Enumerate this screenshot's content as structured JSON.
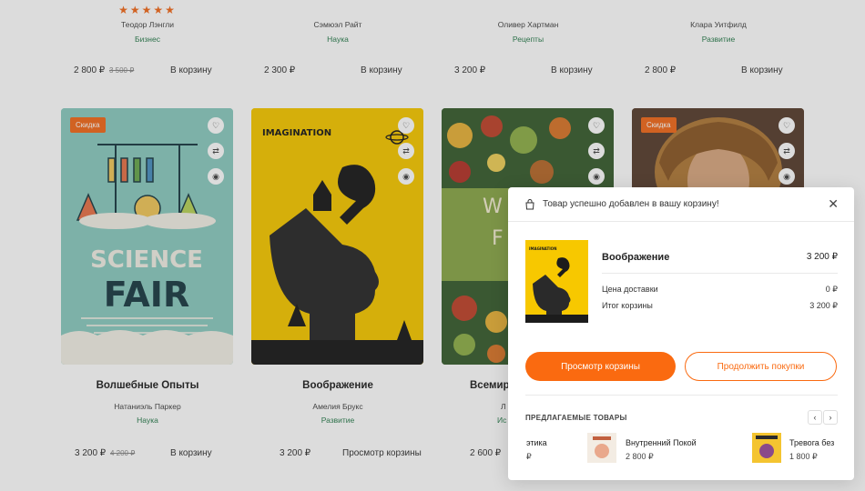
{
  "top_row": [
    {
      "stars": "★★★★★",
      "author": "Теодор Лэнгли",
      "category": "Бизнес",
      "price": "2 800 ₽",
      "old_price": "3 500 ₽",
      "cart": "В корзину"
    },
    {
      "stars": "",
      "author": "Сэмюэл Райт",
      "category": "Наука",
      "price": "2 300 ₽",
      "old_price": "",
      "cart": "В корзину"
    },
    {
      "stars": "",
      "author": "Оливер Хартман",
      "category": "Рецепты",
      "price": "3 200 ₽",
      "old_price": "",
      "cart": "В корзину"
    },
    {
      "stars": "",
      "author": "Клара Уитфилд",
      "category": "Развитие",
      "price": "2 800 ₽",
      "old_price": "",
      "cart": "В корзину"
    }
  ],
  "books": [
    {
      "badge": "Скидка",
      "cover_title_1": "SCIENCE",
      "cover_title_2": "FAIR",
      "title": "Волшебные Опыты",
      "author": "Натаниэль Паркер",
      "category": "Наука",
      "price": "3 200 ₽",
      "old_price": "4 200 ₽",
      "cart": "В корзину"
    },
    {
      "badge": "",
      "cover_brand": "IMAGINATION",
      "title": "Воображение",
      "author": "Амелия Брукс",
      "category": "Развитие",
      "price": "3 200 ₽",
      "old_price": "",
      "cart": "Просмотр корзины"
    },
    {
      "badge": "",
      "cover_text_1": "W",
      "cover_text_2": "F",
      "title": "Всемир",
      "author": "Л",
      "category": "Ис",
      "price": "2 600 ₽",
      "old_price": "",
      "cart": ""
    },
    {
      "badge": "Скидка",
      "title": "",
      "author": "",
      "category": "",
      "price": "",
      "old_price": "",
      "cart": ""
    }
  ],
  "modal": {
    "message": "Товар успешно добавлен в вашу корзину!",
    "product_name": "Воображение",
    "product_price": "3 200 ₽",
    "thumb_brand": "IMAGINATION",
    "delivery_label": "Цена доставки",
    "delivery_value": "0 ₽",
    "total_label": "Итог корзины",
    "total_value": "3 200 ₽",
    "view_cart": "Просмотр корзины",
    "continue": "Продолжить покупки",
    "suggested_title": "ПРЕДЛАГАЕМЫЕ ТОВАРЫ",
    "suggested": [
      {
        "name": "этика",
        "price": "₽"
      },
      {
        "name": "Внутренний Покой",
        "price": "2 800 ₽"
      },
      {
        "name": "Тревога без",
        "price": "1 800 ₽"
      }
    ]
  },
  "colors": {
    "accent": "#fa6a10",
    "category_green": "#2a7d4e",
    "cover_yellow": "#f7c800",
    "cover_teal": "#8ccbc0"
  },
  "icons": [
    "heart-icon",
    "shuffle-icon",
    "eye-icon",
    "bag-icon",
    "close-icon",
    "chevron-left-icon",
    "chevron-right-icon",
    "star-icon"
  ]
}
